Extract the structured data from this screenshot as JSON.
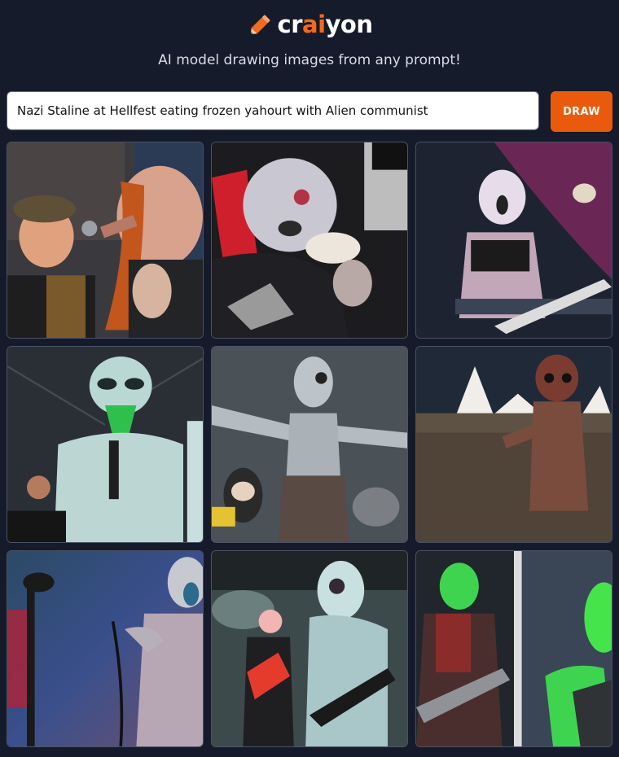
{
  "header": {
    "logo_prefix": "cr",
    "logo_accent": "ai",
    "logo_suffix": "yon",
    "tagline": "AI model drawing images from any prompt!"
  },
  "prompt": {
    "value": "Nazi Staline at Hellfest eating frozen yahourt with Alien communist",
    "button_label": "DRAW"
  },
  "colors": {
    "background": "#151b2a",
    "accent": "#f26a1b",
    "button": "#ea5a0c"
  },
  "results": [
    {
      "id": 1,
      "subject": "two singers with microphones"
    },
    {
      "id": 2,
      "subject": "pale figure in red hood eating"
    },
    {
      "id": 3,
      "subject": "alien singer on stage with guitar"
    },
    {
      "id": 4,
      "subject": "green alien holding microphone"
    },
    {
      "id": 5,
      "subject": "grey alien with arms spread on stage"
    },
    {
      "id": 6,
      "subject": "red alien in front of crowd and tents"
    },
    {
      "id": 7,
      "subject": "alien singer with microphone stand"
    },
    {
      "id": 8,
      "subject": "alien guitarist with red guitar player"
    },
    {
      "id": 9,
      "subject": "green alien band playing guitar"
    }
  ]
}
